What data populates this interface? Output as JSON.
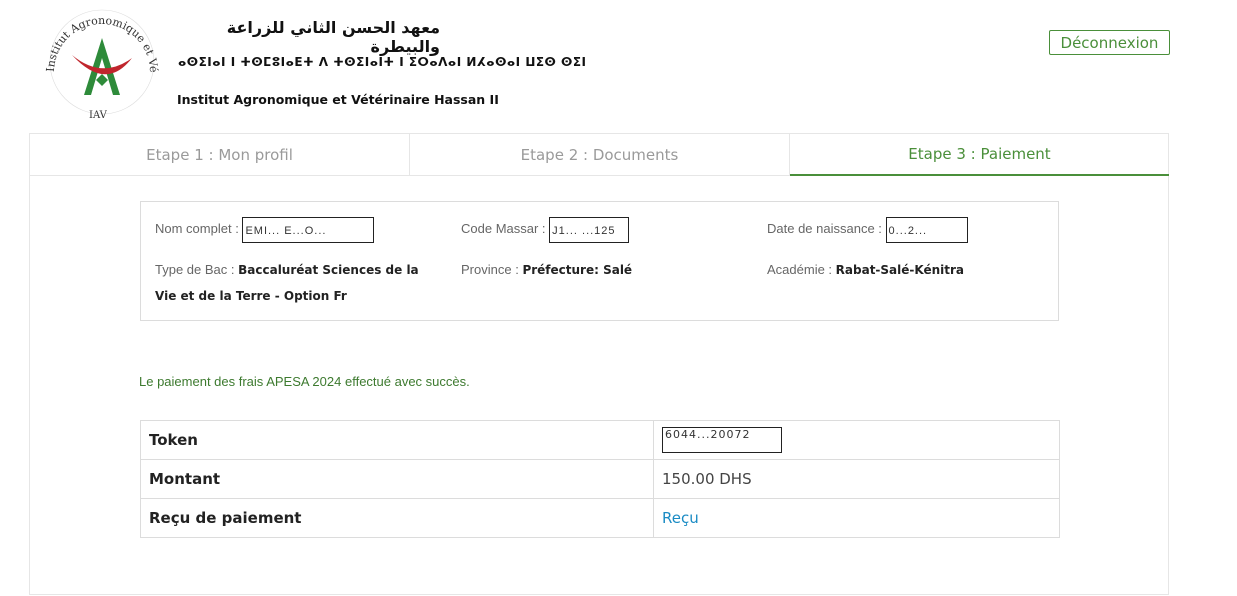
{
  "header": {
    "institute_arabic": "معهد الحسن الثاني للزراعة والبيطرة",
    "institute_tifinagh": "ⴰⵙⵉⵏⴰⵏ ⵏ ⵜⵙⵎⵓⵏⴰⴹⵜ ⴷ ⵜⵙⵉⵏⴰⵏⵜ ⵏ ⵉⵔⴰⴷⴰⵏ ⵍⵃⴰⵙⴰⵏ ⵡⵉⵙ ⵙⵉⵏ",
    "institute_french": "Institut Agronomique et Vétérinaire Hassan II",
    "logo_text_top": "Institut Agronomique et Vétérinaire Hassan II",
    "logo_text_bottom": "IAV",
    "logout_label": "Déconnexion"
  },
  "steps": [
    {
      "label": "Etape 1 : Mon profil",
      "active": false
    },
    {
      "label": "Etape 2 : Documents",
      "active": false
    },
    {
      "label": "Etape 3 : Paiement",
      "active": true
    }
  ],
  "profile": {
    "nom_label": "Nom complet :",
    "nom_value": "EMI... E...O...",
    "massar_label": "Code Massar :",
    "massar_value": "J1... ...125",
    "naissance_label": "Date de naissance :",
    "naissance_value": "0...2...",
    "bac_label": "Type de Bac :",
    "bac_value_line1": "Baccaluréat Sciences de la",
    "bac_value_line2": "Vie et de la Terre - Option Fr",
    "province_label": "Province :",
    "province_value": "Préfecture: Salé",
    "academie_label": "Académie :",
    "academie_value": "Rabat-Salé-Kénitra"
  },
  "success_message": "Le paiement des frais APESA 2024 effectué avec succès.",
  "payment": {
    "token_label": "Token",
    "token_value": "6044...20072",
    "montant_label": "Montant",
    "montant_value": "150.00 DHS",
    "recu_label": "Reçu de paiement",
    "recu_link": "Reçu"
  },
  "colors": {
    "accent_green": "#4a8f3a",
    "link_blue": "#1a8bc4",
    "logo_red": "#c0262d",
    "logo_green": "#2e8b3a"
  }
}
